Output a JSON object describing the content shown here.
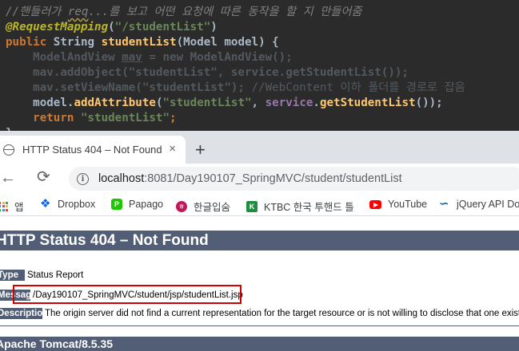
{
  "code": {
    "comment_line": "//핸들러가 req...를 보고 어떤 요청에 따른 동작을 할 지 만들어줌",
    "comment_pre": "//핸들러가 ",
    "comment_typo": "req",
    "comment_post": "...를 보고 어떤 요청에 따른 동작을 할 지 만들어줌",
    "annotation": "@RequestMapping",
    "mapping_value": "\"/studentList\"",
    "kw_public": "public",
    "return_type": "String",
    "method_name": "studentList",
    "param_type": "Model",
    "param_name": "model",
    "mav_type": "ModelAndView",
    "mav_var": "mav",
    "kw_new": "new",
    "mav_ctor": "ModelAndView();",
    "add_object_call": "mav.addObject(\"studentList\", service.getStudentList());",
    "set_view_call": "mav.setViewName(\"studentList\");",
    "set_view_comment": "//WebContent 이하 폴더를 경로로 잡음",
    "model_var": "model",
    "add_attribute": "addAttribute",
    "attr_key": "\"studentList\"",
    "service_field": "service",
    "get_list": "getStudentList",
    "kw_return": "return",
    "return_value": "\"studentList\""
  },
  "browser": {
    "tab_title": "HTTP Status 404 – Not Found",
    "tab_close": "×",
    "new_tab": "+",
    "url_host": "localhost",
    "url_rest": ":8081/Day190107_SpringMVC/student/studentList",
    "info_icon": "i"
  },
  "bookmarks": [
    {
      "label": "앱",
      "icon": "apps-grid-icon"
    },
    {
      "label": "Dropbox",
      "icon": "dropbox-icon"
    },
    {
      "label": "Papago",
      "icon": "papago-icon"
    },
    {
      "label": "한글입숨",
      "icon": "hangul-icon"
    },
    {
      "label": "KTBC 한국 투핸드 틀",
      "icon": "ktbc-icon"
    },
    {
      "label": "YouTube",
      "icon": "youtube-icon"
    },
    {
      "label": "jQuery API Do",
      "icon": "jquery-icon"
    }
  ],
  "page": {
    "title": "HTTP Status 404 – Not Found",
    "type_label": "Type",
    "type_value": "Status Report",
    "message_label": "Message",
    "message_value": "/Day190107_SpringMVC/student/jsp/studentList.jsp",
    "description_label": "Description",
    "description_value": "The origin server did not find a current representation for the target resource or is not willing to disclose that one exists.",
    "footer": "Apache Tomcat/8.5.35"
  },
  "colors": {
    "editor_bg": "#2b2b2b",
    "tomcat_header": "#525d76",
    "highlight_box": "#d40000",
    "tabstrip_bg": "#dee1e6"
  }
}
